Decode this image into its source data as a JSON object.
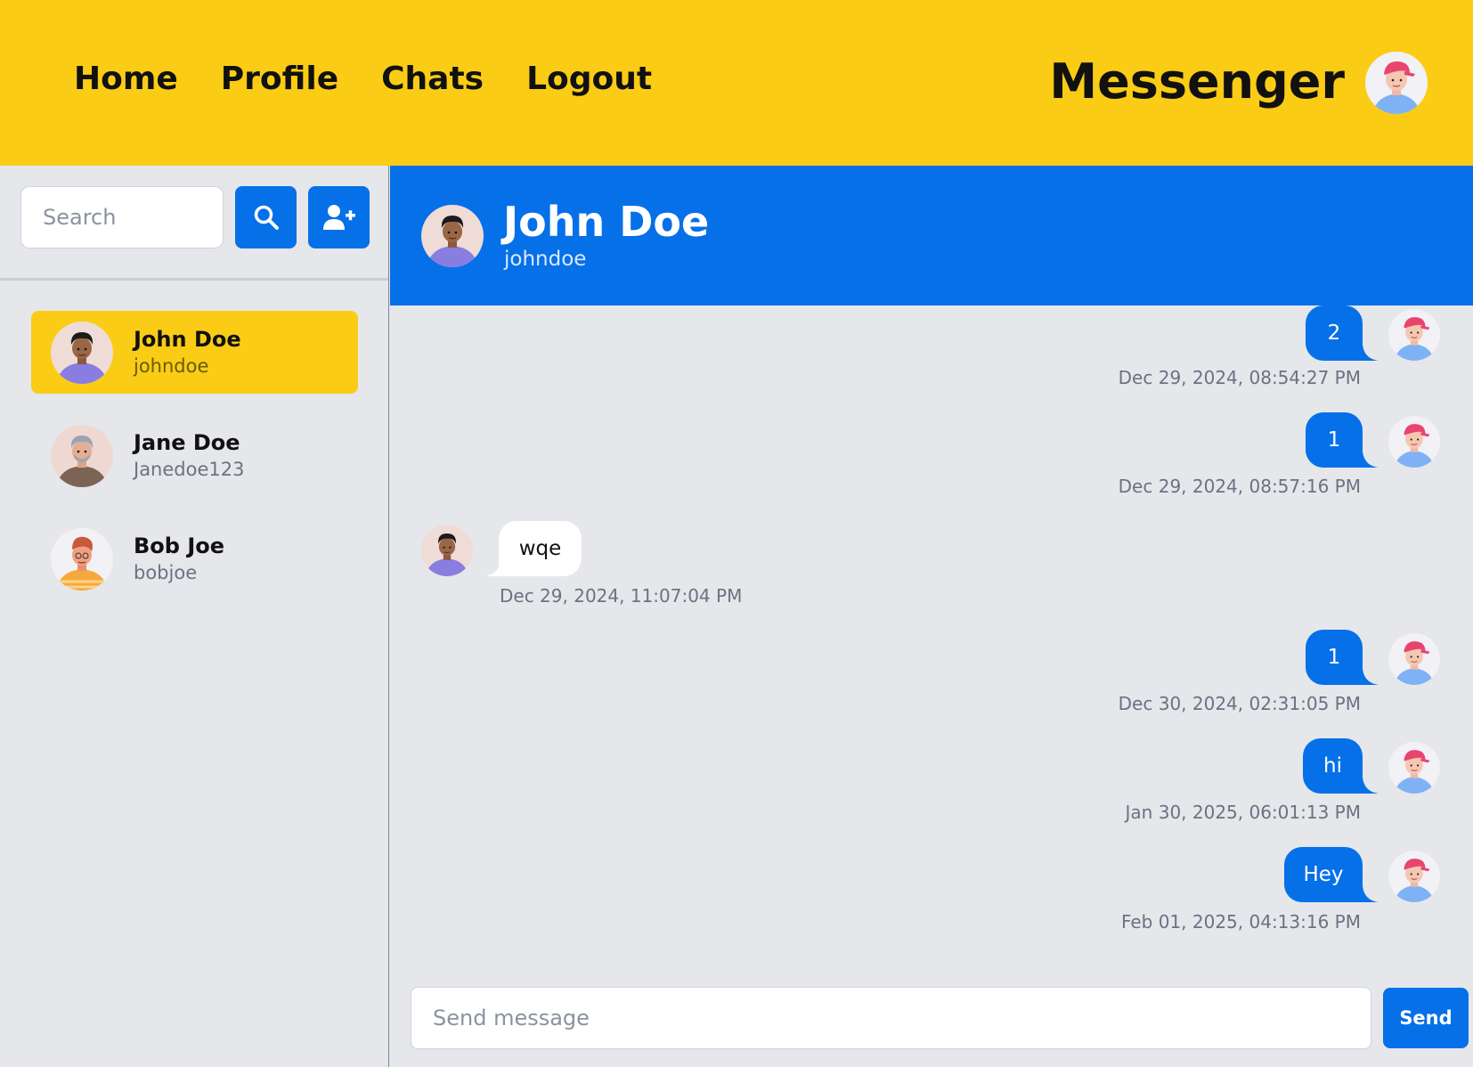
{
  "nav": {
    "items": [
      {
        "label": "Home"
      },
      {
        "label": "Profile"
      },
      {
        "label": "Chats"
      },
      {
        "label": "Logout"
      }
    ],
    "brand": "Messenger"
  },
  "sidebar": {
    "search_placeholder": "Search",
    "contacts": [
      {
        "name": "John Doe",
        "username": "johndoe",
        "active": true
      },
      {
        "name": "Jane Doe",
        "username": "Janedoe123",
        "active": false
      },
      {
        "name": "Bob Joe",
        "username": "bobjoe",
        "active": false
      }
    ]
  },
  "chat": {
    "name": "John Doe",
    "username": "johndoe"
  },
  "messages": [
    {
      "text": "2",
      "time": "Dec 29, 2024, 08:54:27 PM",
      "direction": "out"
    },
    {
      "text": "1",
      "time": "Dec 29, 2024, 08:57:16 PM",
      "direction": "out"
    },
    {
      "text": "wqe",
      "time": "Dec 29, 2024, 11:07:04 PM",
      "direction": "in"
    },
    {
      "text": "1",
      "time": "Dec 30, 2024, 02:31:05 PM",
      "direction": "out"
    },
    {
      "text": "hi",
      "time": "Jan 30, 2025, 06:01:13 PM",
      "direction": "out"
    },
    {
      "text": "Hey",
      "time": "Feb 01, 2025, 04:13:16 PM",
      "direction": "out"
    }
  ],
  "composer": {
    "placeholder": "Send message",
    "send_label": "Send"
  },
  "colors": {
    "header_yellow": "#facc15",
    "primary_blue": "#0670e8",
    "background": "#e5e7eb"
  }
}
